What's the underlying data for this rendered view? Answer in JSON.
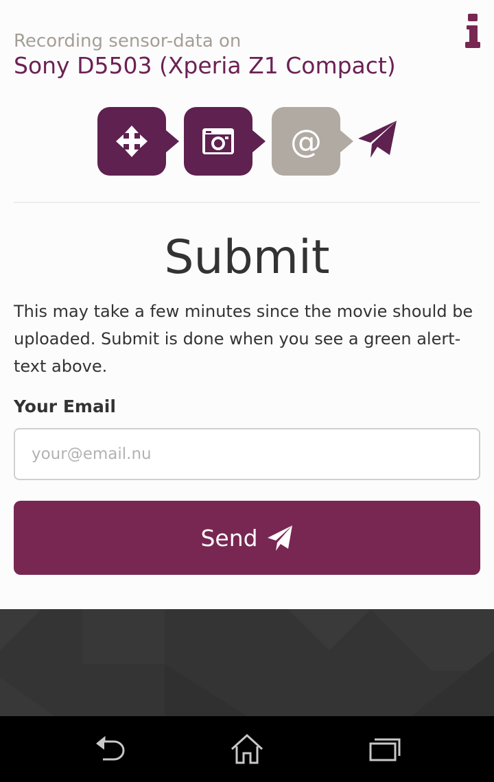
{
  "header": {
    "subtitle": "Recording sensor-data on",
    "device_name": "Sony D5503 (Xperia Z1 Compact)",
    "info_icon": "info-icon"
  },
  "steps": [
    {
      "icon": "move-arrows-icon",
      "state": "done"
    },
    {
      "icon": "camera-icon",
      "state": "done"
    },
    {
      "icon": "at-sign-icon",
      "state": "current"
    },
    {
      "icon": "paper-plane-icon",
      "state": "final"
    }
  ],
  "main": {
    "title": "Submit",
    "description": "This may take a few minutes since the movie should be uploaded. Submit is done when you see a green alert-text above.",
    "email_label": "Your Email",
    "email_placeholder": "your@email.nu",
    "email_value": "",
    "send_label": "Send",
    "send_icon": "paper-plane-icon"
  },
  "navbar": {
    "back_icon": "back-icon",
    "home_icon": "home-icon",
    "recents_icon": "recent-apps-icon"
  },
  "colors": {
    "brand": "#782752",
    "step_done": "#5e2150",
    "step_current": "#b1aaa3",
    "device_text": "#6b2154",
    "subtitle_text": "#a59e97",
    "footer": "#343434",
    "navbar": "#000000"
  }
}
